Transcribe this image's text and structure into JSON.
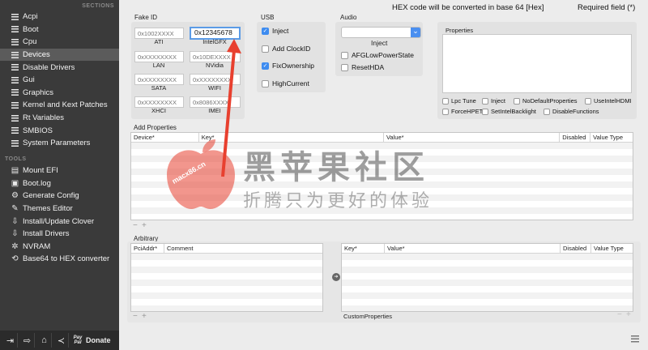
{
  "sidebar": {
    "sections_title": "SECTIONS",
    "tools_title": "TOOLS",
    "sections": [
      {
        "label": "Acpi"
      },
      {
        "label": "Boot"
      },
      {
        "label": "Cpu"
      },
      {
        "label": "Devices",
        "active": true
      },
      {
        "label": "Disable Drivers"
      },
      {
        "label": "Gui"
      },
      {
        "label": "Graphics"
      },
      {
        "label": "Kernel and Kext Patches"
      },
      {
        "label": "Rt Variables"
      },
      {
        "label": "SMBIOS"
      },
      {
        "label": "System Parameters"
      }
    ],
    "tools": [
      {
        "label": "Mount EFI",
        "icon": "disk-icon"
      },
      {
        "label": "Boot.log",
        "icon": "document-icon"
      },
      {
        "label": "Generate Config",
        "icon": "gear-icon"
      },
      {
        "label": "Themes Editor",
        "icon": "brush-icon"
      },
      {
        "label": "Install/Update Clover",
        "icon": "download-icon"
      },
      {
        "label": "Install Drivers",
        "icon": "download-icon"
      },
      {
        "label": "NVRAM",
        "icon": "chip-icon"
      },
      {
        "label": "Base64 to HEX converter",
        "icon": "convert-icon"
      }
    ],
    "bottom": {
      "donate_label": "Donate",
      "pay_label": "Pay Pal"
    }
  },
  "header": {
    "hex_note": "HEX code will be converted in base 64 [Hex]",
    "required_note": "Required field (*)"
  },
  "fake_id": {
    "title": "Fake ID",
    "fields": [
      {
        "label": "ATI",
        "value": "",
        "placeholder": "0x1002XXXX"
      },
      {
        "label": "IntelGFX",
        "value": "0x12345678",
        "placeholder": ""
      },
      {
        "label": "LAN",
        "value": "",
        "placeholder": "0xXXXXXXXX"
      },
      {
        "label": "NVidia",
        "value": "",
        "placeholder": "0x10DEXXXX"
      },
      {
        "label": "SATA",
        "value": "",
        "placeholder": "0xXXXXXXXX"
      },
      {
        "label": "WIFI",
        "value": "",
        "placeholder": "0xXXXXXXXX"
      },
      {
        "label": "XHCI",
        "value": "",
        "placeholder": "0xXXXXXXXX"
      },
      {
        "label": "IMEI",
        "value": "",
        "placeholder": "0x8086XXXX"
      }
    ]
  },
  "usb": {
    "title": "USB",
    "options": [
      {
        "label": "Inject",
        "checked": true
      },
      {
        "label": "Add ClockID",
        "checked": false
      },
      {
        "label": "FixOwnership",
        "checked": true
      },
      {
        "label": "HighCurrent",
        "checked": false
      }
    ]
  },
  "audio": {
    "title": "Audio",
    "select_value": "",
    "inject_label": "Inject",
    "options": [
      {
        "label": "AFGLowPowerState",
        "checked": false
      },
      {
        "label": "ResetHDA",
        "checked": false
      }
    ]
  },
  "properties": {
    "title": "Properties",
    "options": [
      {
        "label": "Lpc Tune",
        "checked": false
      },
      {
        "label": "Inject",
        "checked": false
      },
      {
        "label": "NoDefaultProperties",
        "checked": false
      },
      {
        "label": "UseIntelHDMI",
        "checked": false
      },
      {
        "label": "ForceHPET",
        "checked": false
      },
      {
        "label": "SetIntelBacklight",
        "checked": false
      },
      {
        "label": "DisableFunctions",
        "checked": false
      }
    ]
  },
  "add_properties": {
    "title": "Add Properties",
    "columns": [
      "Device*",
      "Key*",
      "Value*",
      "Disabled",
      "Value Type"
    ]
  },
  "arbitrary": {
    "title": "Arbitrary",
    "left_columns": [
      "PciAddr*",
      "Comment"
    ],
    "right_columns": [
      "Key*",
      "Value*",
      "Disabled",
      "Value Type"
    ],
    "custom_properties_label": "CustomProperties"
  },
  "controls": {
    "minus": "−",
    "plus": "+",
    "arrow": "➔",
    "dropdown": "⌄"
  },
  "watermark": {
    "title": "黑苹果社区",
    "subtitle": "折腾只为更好的体验",
    "logo_text": "macx86.cn"
  },
  "colors": {
    "accent": "#3e8cf0",
    "annotation_arrow": "#e8402f",
    "sidebar_bg": "#3a3a3a"
  }
}
